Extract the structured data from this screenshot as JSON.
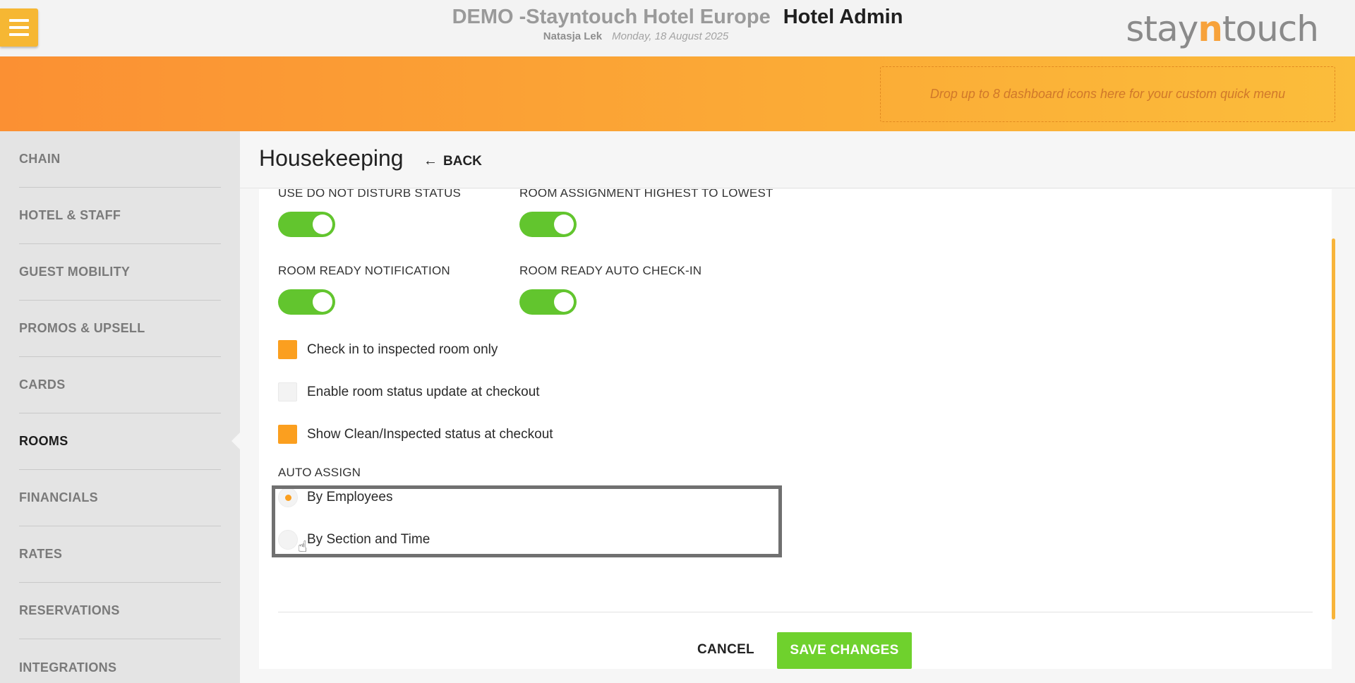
{
  "header": {
    "hotel_name": "DEMO -Stayntouch Hotel Europe",
    "section_title": "Hotel Admin",
    "user_name": "Natasja Lek",
    "date": "Monday, 18 August 2025",
    "logo_prefix": "stay",
    "logo_n": "n",
    "logo_suffix": "touch"
  },
  "banner": {
    "dropzone_text": "Drop up to 8 dashboard icons here for your custom quick menu"
  },
  "sidebar": {
    "items": [
      {
        "label": "CHAIN"
      },
      {
        "label": "HOTEL & STAFF"
      },
      {
        "label": "GUEST MOBILITY"
      },
      {
        "label": "PROMOS & UPSELL"
      },
      {
        "label": "CARDS"
      },
      {
        "label": "ROOMS",
        "active": true
      },
      {
        "label": "FINANCIALS"
      },
      {
        "label": "RATES"
      },
      {
        "label": "RESERVATIONS"
      },
      {
        "label": "INTEGRATIONS"
      }
    ]
  },
  "main": {
    "title": "Housekeeping",
    "back_label": "BACK",
    "toggles": [
      {
        "label": "USE DO NOT DISTURB STATUS",
        "on": true
      },
      {
        "label": "ROOM ASSIGNMENT HIGHEST TO LOWEST",
        "on": true
      },
      {
        "label": "ROOM READY NOTIFICATION",
        "on": true
      },
      {
        "label": "ROOM READY AUTO CHECK-IN",
        "on": true
      }
    ],
    "checkboxes": [
      {
        "label": "Check in to inspected room only",
        "checked": true
      },
      {
        "label": "Enable room status update at checkout",
        "checked": false
      },
      {
        "label": "Show Clean/Inspected status at checkout",
        "checked": true
      }
    ],
    "auto_assign": {
      "label": "AUTO ASSIGN",
      "options": [
        {
          "label": "By Employees",
          "selected": true
        },
        {
          "label": "By Section and Time",
          "selected": false
        }
      ]
    },
    "cancel_label": "CANCEL",
    "save_label": "SAVE CHANGES"
  },
  "colors": {
    "accent_orange": "#fb9f1f",
    "toggle_green": "#62c52e",
    "save_green": "#6fd12d"
  }
}
